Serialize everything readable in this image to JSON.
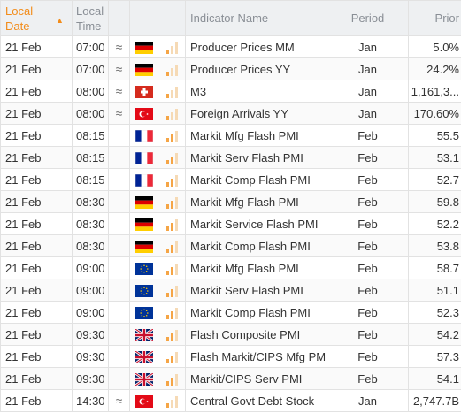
{
  "header": {
    "date_line1": "Local",
    "date_line2": "Date",
    "time_line1": "Local",
    "time_line2": "Time",
    "indicator": "Indicator Name",
    "period": "Period",
    "prior": "Prior"
  },
  "colors": {
    "accent": "#f28c1a",
    "bar_active": "#f5a546",
    "bar_inactive": "#f6dab5"
  },
  "rows": [
    {
      "date": "21 Feb",
      "time": "07:00",
      "approx": "≈",
      "flag": "de-flag-icon",
      "importance": 1,
      "name": "Producer Prices MM",
      "period": "Jan",
      "prior": "5.0%"
    },
    {
      "date": "21 Feb",
      "time": "07:00",
      "approx": "≈",
      "flag": "de-flag-icon",
      "importance": 1,
      "name": "Producer Prices YY",
      "period": "Jan",
      "prior": "24.2%"
    },
    {
      "date": "21 Feb",
      "time": "08:00",
      "approx": "≈",
      "flag": "ch-flag-icon",
      "importance": 1,
      "name": "M3",
      "period": "Jan",
      "prior": "1,161,3..."
    },
    {
      "date": "21 Feb",
      "time": "08:00",
      "approx": "≈",
      "flag": "tr-flag-icon",
      "importance": 1,
      "name": "Foreign Arrivals YY",
      "period": "Jan",
      "prior": "170.60%"
    },
    {
      "date": "21 Feb",
      "time": "08:15",
      "approx": "",
      "flag": "fr-flag-icon",
      "importance": 2,
      "name": "Markit Mfg Flash PMI",
      "period": "Feb",
      "prior": "55.5"
    },
    {
      "date": "21 Feb",
      "time": "08:15",
      "approx": "",
      "flag": "fr-flag-icon",
      "importance": 2,
      "name": "Markit Serv Flash PMI",
      "period": "Feb",
      "prior": "53.1"
    },
    {
      "date": "21 Feb",
      "time": "08:15",
      "approx": "",
      "flag": "fr-flag-icon",
      "importance": 2,
      "name": "Markit Comp Flash PMI",
      "period": "Feb",
      "prior": "52.7"
    },
    {
      "date": "21 Feb",
      "time": "08:30",
      "approx": "",
      "flag": "de-flag-icon",
      "importance": 2,
      "name": "Markit Mfg Flash PMI",
      "period": "Feb",
      "prior": "59.8"
    },
    {
      "date": "21 Feb",
      "time": "08:30",
      "approx": "",
      "flag": "de-flag-icon",
      "importance": 2,
      "name": "Markit Service Flash PMI",
      "period": "Feb",
      "prior": "52.2"
    },
    {
      "date": "21 Feb",
      "time": "08:30",
      "approx": "",
      "flag": "de-flag-icon",
      "importance": 2,
      "name": "Markit Comp Flash PMI",
      "period": "Feb",
      "prior": "53.8"
    },
    {
      "date": "21 Feb",
      "time": "09:00",
      "approx": "",
      "flag": "eu-flag-icon",
      "importance": 2,
      "name": "Markit Mfg Flash PMI",
      "period": "Feb",
      "prior": "58.7"
    },
    {
      "date": "21 Feb",
      "time": "09:00",
      "approx": "",
      "flag": "eu-flag-icon",
      "importance": 2,
      "name": "Markit Serv Flash PMI",
      "period": "Feb",
      "prior": "51.1"
    },
    {
      "date": "21 Feb",
      "time": "09:00",
      "approx": "",
      "flag": "eu-flag-icon",
      "importance": 2,
      "name": "Markit Comp Flash PMI",
      "period": "Feb",
      "prior": "52.3"
    },
    {
      "date": "21 Feb",
      "time": "09:30",
      "approx": "",
      "flag": "gb-flag-icon",
      "importance": 2,
      "name": "Flash Composite PMI",
      "period": "Feb",
      "prior": "54.2"
    },
    {
      "date": "21 Feb",
      "time": "09:30",
      "approx": "",
      "flag": "gb-flag-icon",
      "importance": 2,
      "name": "Flash Markit/CIPS Mfg PMI",
      "period": "Feb",
      "prior": "57.3"
    },
    {
      "date": "21 Feb",
      "time": "09:30",
      "approx": "",
      "flag": "gb-flag-icon",
      "importance": 2,
      "name": "Markit/CIPS Serv PMI",
      "period": "Feb",
      "prior": "54.1"
    },
    {
      "date": "21 Feb",
      "time": "14:30",
      "approx": "≈",
      "flag": "tr-flag-icon",
      "importance": 1,
      "name": "Central Govt Debt Stock",
      "period": "Jan",
      "prior": "2,747.7B"
    }
  ]
}
